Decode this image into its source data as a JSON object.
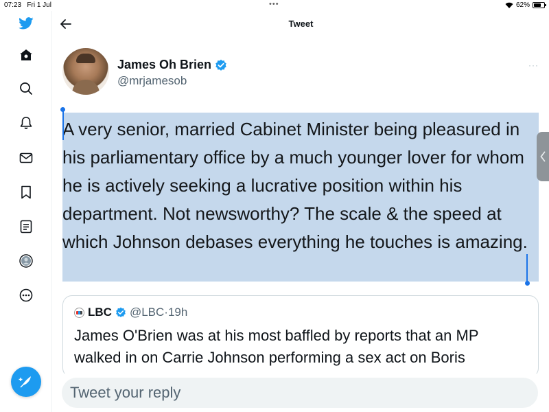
{
  "status_bar": {
    "time": "07:23",
    "date": "Fri 1 Jul",
    "multitask": "•••",
    "wifi_icon": "wifi-icon",
    "battery_percent": "62%",
    "battery_level": 0.62
  },
  "sidebar": {
    "items": [
      {
        "name": "twitter-logo-icon"
      },
      {
        "name": "home-icon"
      },
      {
        "name": "search-icon"
      },
      {
        "name": "notifications-bell-icon"
      },
      {
        "name": "messages-envelope-icon"
      },
      {
        "name": "bookmarks-icon"
      },
      {
        "name": "lists-icon"
      },
      {
        "name": "profile-icon"
      },
      {
        "name": "more-options-icon"
      }
    ],
    "compose_icon": "compose-feather-icon"
  },
  "header": {
    "title": "Tweet",
    "back_icon": "back-arrow-icon"
  },
  "tweet": {
    "author_name": "James Oh Brien",
    "author_handle": "@mrjamesob",
    "verified_icon": "verified-badge-icon",
    "more_label": "···",
    "text": "A very senior, married Cabinet Minister being pleasured in his parliamentary office by a much younger lover for whom he is actively seeking a lucrative position within his department. Not newsworthy? The scale & the speed at which Johnson debases everything he touches is amazing.",
    "selection_color": "#c5d8ec"
  },
  "quoted_tweet": {
    "name": "LBC",
    "handle": "@LBC",
    "separator": "·",
    "time": "19h",
    "text": "James O'Brien was at his most baffled by reports that an MP walked in on Carrie Johnson performing a sex act on Boris Johnson, as he sought to get her a top Foreign Office"
  },
  "reply": {
    "placeholder": "Tweet your reply"
  },
  "colors": {
    "accent": "#1d9bf0",
    "selection_handle": "#1a73e8"
  }
}
